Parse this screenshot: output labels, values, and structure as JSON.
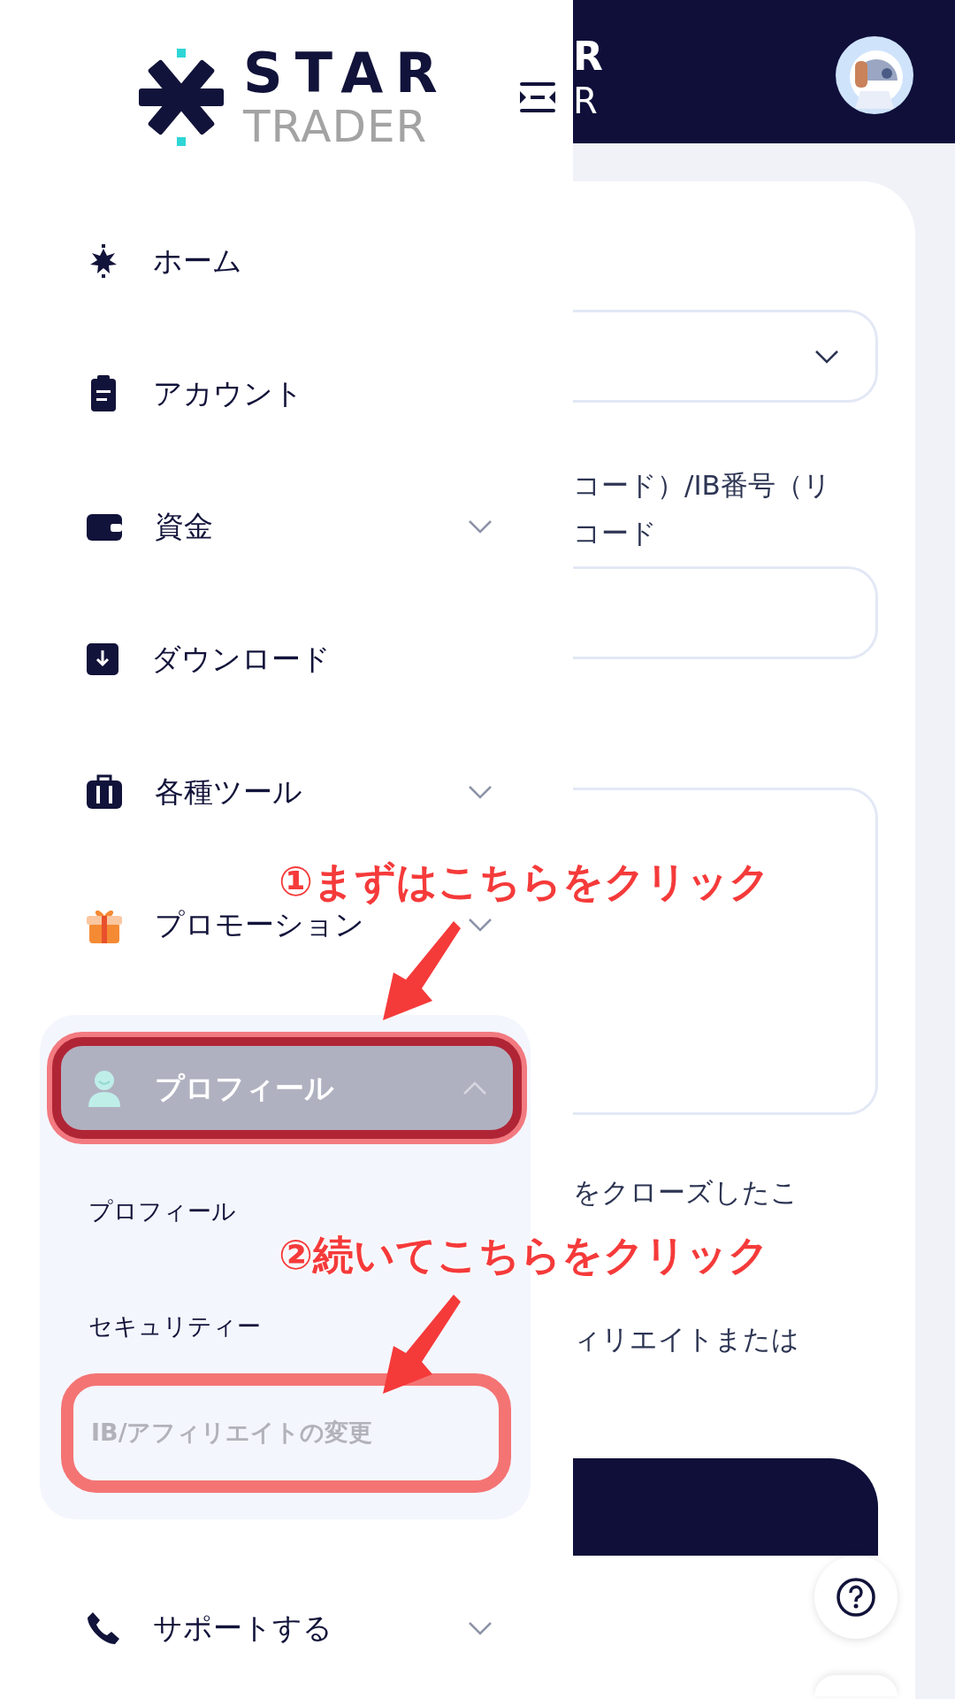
{
  "logo": {
    "line1": "STAR",
    "line2": "TRADER"
  },
  "header": {
    "logo_fragment": [
      "R",
      "R"
    ]
  },
  "menu": [
    {
      "label": "ホーム",
      "expandable": false,
      "selected": false
    },
    {
      "label": "アカウント",
      "expandable": false,
      "selected": false
    },
    {
      "label": "資金",
      "expandable": true,
      "selected": false
    },
    {
      "label": "ダウンロード",
      "expandable": false,
      "selected": false
    },
    {
      "label": "各種ツール",
      "expandable": true,
      "selected": false
    },
    {
      "label": "プロモーション",
      "expandable": true,
      "selected": false
    },
    {
      "label": "プロフィール",
      "expandable": true,
      "expanded": true,
      "selected": true,
      "children": [
        {
          "label": "プロフィール",
          "disabled": false
        },
        {
          "label": "セキュリティー",
          "disabled": false
        },
        {
          "label": "IB/アフィリエイトの変更",
          "disabled": true
        }
      ]
    },
    {
      "label": "サポートする",
      "expandable": true,
      "selected": false
    }
  ],
  "form": {
    "label_lines": [
      "コード）/IB番号（リ",
      "コード"
    ],
    "note_lines": [
      "をクローズしたこ",
      "ィリエイトまたは"
    ]
  },
  "annotations": [
    {
      "text": "①まずはこちらをクリック"
    },
    {
      "text": "②続いてこちらをクリック"
    }
  ]
}
